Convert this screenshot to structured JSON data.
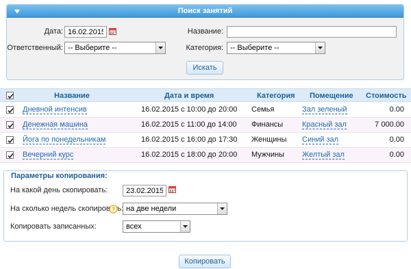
{
  "search": {
    "header_title": "Поиск занятий",
    "date_label": "Дата:",
    "date_value": "16.02.2015",
    "name_label": "Название:",
    "name_value": "",
    "responsible_label": "Ответственный:",
    "responsible_value": "-- Выберите --",
    "category_label": "Категория:",
    "category_value": "-- Выберите --",
    "search_button": "Искать"
  },
  "table": {
    "columns": [
      "Название",
      "Дата и время",
      "Категория",
      "Помещение",
      "Стоимость"
    ],
    "rows": [
      {
        "name": "Дневной интенсив",
        "datetime": "16.02.2015 с 10:00 до 20:00",
        "category": "Семья",
        "room": "Зал зеленый",
        "cost": "0.00"
      },
      {
        "name": "Денежная машина",
        "datetime": "16.02.2015 с 11:00 до 14:00",
        "category": "Финансы",
        "room": "Красный зал",
        "cost": "7 000.00"
      },
      {
        "name": "Йога по понедельникам",
        "datetime": "16.02.2015 с 16:00 до 17:30",
        "category": "Женщины",
        "room": "Синий зал",
        "cost": "0.00"
      },
      {
        "name": "Вечерний курс",
        "datetime": "16.02.2015 с 18:00 до 20:00",
        "category": "Мужчины",
        "room": "Желтый зал",
        "cost": "0.00"
      }
    ]
  },
  "copy": {
    "title": "Параметры копирования:",
    "day_label": "На какой день скопировать:",
    "day_value": "23.02.2015",
    "weeks_label": "На сколько недель скопировать:",
    "weeks_value": "на две недели",
    "enrolled_label": "Копировать записанных:",
    "enrolled_value": "всех",
    "copy_button": "Копировать"
  },
  "colors": {
    "header_blue": "#3d98d9",
    "link_blue": "#1f67b1",
    "alt_row": "#faf3fb",
    "table_header": "#dcebf7"
  },
  "icons": [
    "collapse-arrow-icon",
    "calendar-icon",
    "dropdown-arrow-icon",
    "checkbox-checked-icon",
    "help-icon"
  ]
}
